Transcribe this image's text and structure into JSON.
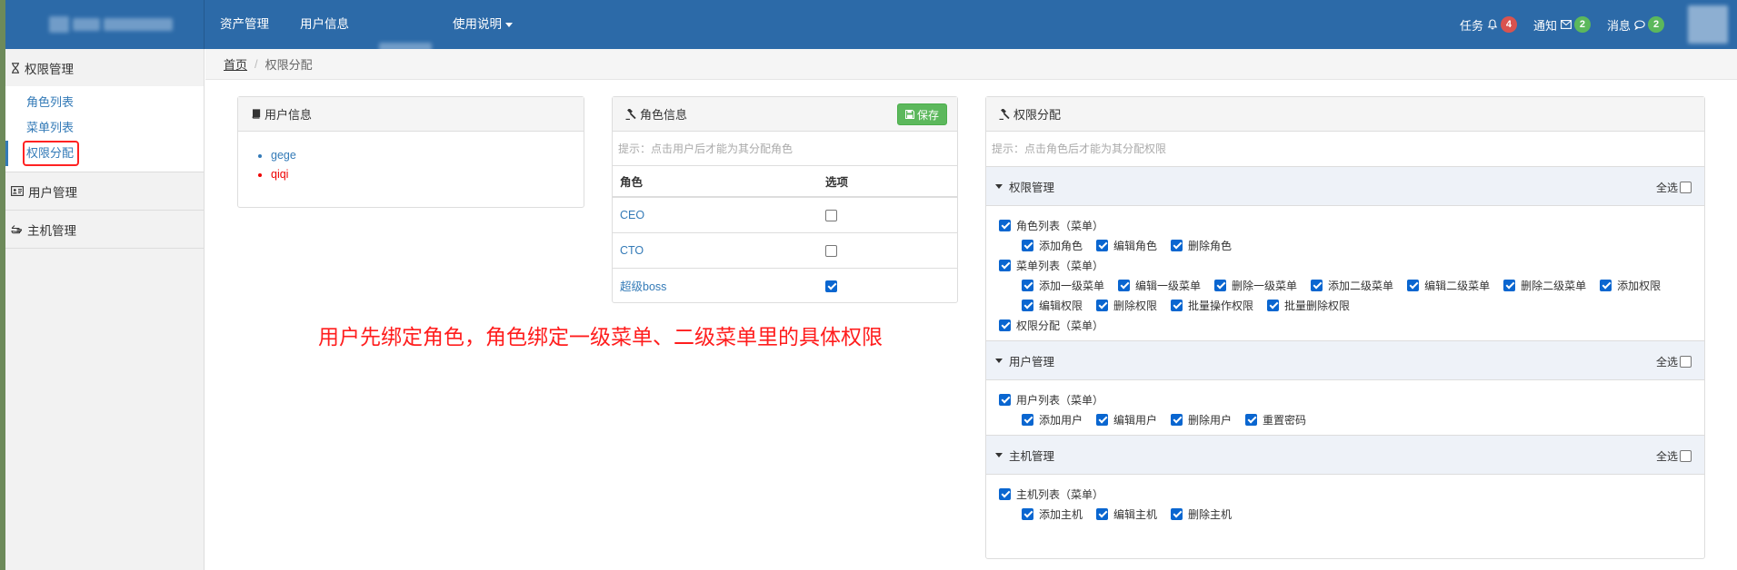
{
  "topnav": {
    "items": [
      "资产管理",
      "用户信息",
      "使用说明"
    ]
  },
  "topright": {
    "tasks_label": "任务",
    "tasks_count": "4",
    "notify_label": "通知",
    "notify_count": "2",
    "messages_label": "消息",
    "messages_count": "2"
  },
  "sidebar": {
    "groups": [
      {
        "label": "权限管理",
        "icon": "hourglass-icon",
        "items": [
          "角色列表",
          "菜单列表",
          "权限分配"
        ]
      },
      {
        "label": "用户管理",
        "icon": "id-card-icon"
      },
      {
        "label": "主机管理",
        "icon": "hand-pointer-icon"
      }
    ],
    "active_item": "权限分配"
  },
  "breadcrumb": {
    "home": "首页",
    "separator": "/",
    "current": "权限分配"
  },
  "user_panel": {
    "title": "用户信息",
    "users": [
      {
        "name": "gege",
        "color": "#337ab7"
      },
      {
        "name": "qiqi",
        "color": "#ee0000"
      }
    ]
  },
  "role_panel": {
    "title": "角色信息",
    "save_label": "保存",
    "hint": "提示：点击用户后才能为其分配角色",
    "col_role": "角色",
    "col_option": "选项",
    "roles": [
      {
        "name": "CEO",
        "checked": false
      },
      {
        "name": "CTO",
        "checked": false
      },
      {
        "name": "超级boss",
        "checked": true
      }
    ]
  },
  "annotation": "用户先绑定角色，角色绑定一级菜单、二级菜单里的具体权限",
  "perm_panel": {
    "title": "权限分配",
    "hint": "提示：点击角色后才能为其分配权限",
    "select_all": "全选",
    "sections": [
      {
        "title": "权限管理",
        "menus": [
          {
            "label": "角色列表（菜单）",
            "perms": [
              "添加角色",
              "编辑角色",
              "删除角色"
            ]
          },
          {
            "label": "菜单列表（菜单）",
            "perms": [
              "添加一级菜单",
              "编辑一级菜单",
              "删除一级菜单",
              "添加二级菜单",
              "编辑二级菜单",
              "删除二级菜单",
              "添加权限",
              "编辑权限",
              "删除权限",
              "批量操作权限",
              "批量删除权限"
            ]
          },
          {
            "label": "权限分配（菜单）",
            "perms": []
          }
        ]
      },
      {
        "title": "用户管理",
        "menus": [
          {
            "label": "用户列表（菜单）",
            "perms": [
              "添加用户",
              "编辑用户",
              "删除用户",
              "重置密码"
            ]
          }
        ]
      },
      {
        "title": "主机管理",
        "menus": [
          {
            "label": "主机列表（菜单）",
            "perms": [
              "添加主机",
              "编辑主机",
              "删除主机"
            ]
          }
        ]
      }
    ]
  },
  "colors": {
    "header_bg": "#2c6aa8",
    "link": "#337ab7",
    "save_green": "#5cb85c",
    "badge_red": "#d9534f",
    "badge_green": "#5cb85c",
    "annotation_red": "#ff1d1d",
    "checkbox_blue": "#0a66d0"
  }
}
